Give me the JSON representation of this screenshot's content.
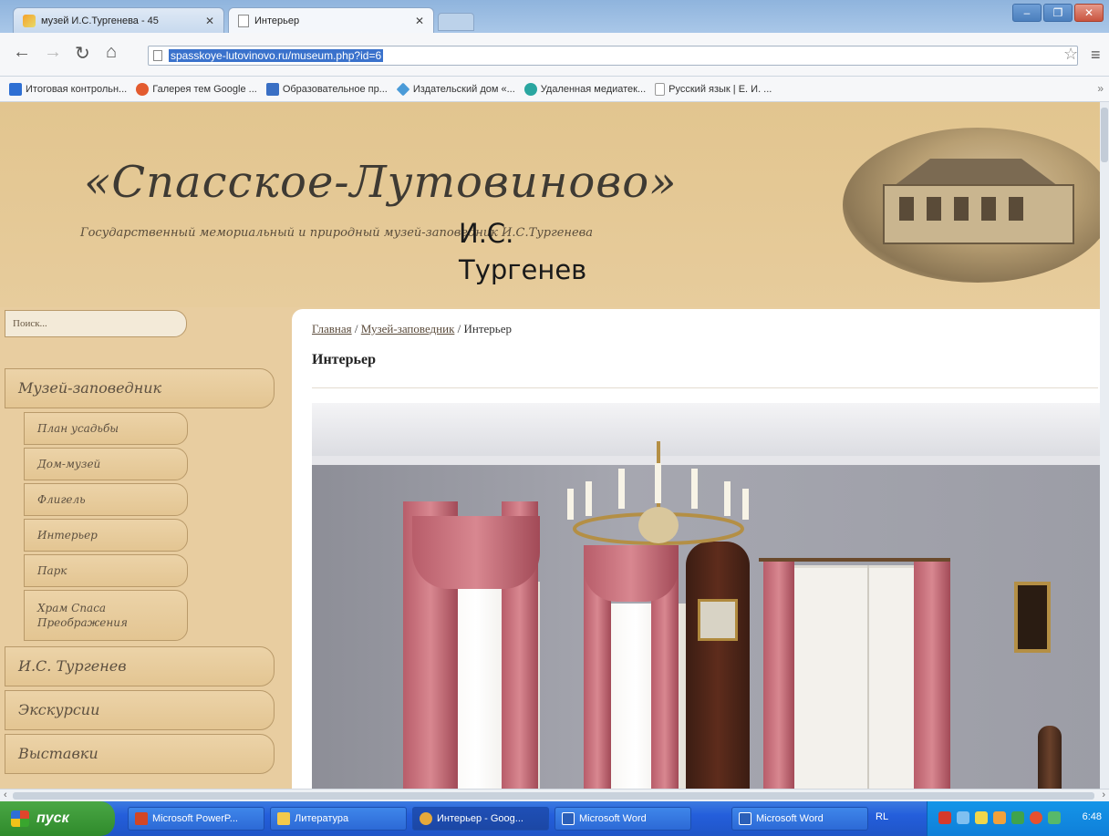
{
  "browser": {
    "tabs": [
      {
        "title": "музей И.С.Тургенева - 45",
        "active": false
      },
      {
        "title": "Интерьер",
        "active": true
      }
    ],
    "address": "spasskoye-lutovinovo.ru/museum.php?id=6",
    "bookmarks": [
      {
        "label": "Итоговая контрольн...",
        "icon": "app-icon",
        "color": "#2e6fd3"
      },
      {
        "label": "Галерея тем Google ...",
        "icon": "chrome-store-icon",
        "color": "#e35b2f"
      },
      {
        "label": "Образовательное пр...",
        "icon": "people-icon",
        "color": "#3a6fc4"
      },
      {
        "label": "Издательский дом «...",
        "icon": "diamond-icon",
        "color": "#4a9bd8"
      },
      {
        "label": "Удаленная медиатек...",
        "icon": "cloud-icon",
        "color": "#2aa6a0"
      },
      {
        "label": "Русский язык | Е. И. ...",
        "icon": "page-icon",
        "color": "#ffffff"
      }
    ]
  },
  "site": {
    "title": "«Спасское-Лутовиново»",
    "subtitle": "Государственный мемориальный и природный музей-заповедник И.С.Тургенева",
    "overlay_lines": [
      "И.С.",
      "Тургенев"
    ]
  },
  "sidebar": {
    "search_placeholder": "Поиск...",
    "sections": [
      {
        "label": "Музей-заповедник"
      },
      {
        "label": "И.С. Тургенев"
      },
      {
        "label": "Экскурсии"
      },
      {
        "label": "Выставки"
      }
    ],
    "subitems": [
      {
        "label": "План усадьбы"
      },
      {
        "label": "Дом-музей"
      },
      {
        "label": "Флигель"
      },
      {
        "label": "Интерьер"
      },
      {
        "label": "Парк"
      },
      {
        "label": "Храм Спаса Преображения"
      }
    ]
  },
  "content": {
    "breadcrumb": {
      "home": "Главная",
      "sep": " / ",
      "section": "Музей-заповедник",
      "current": "Интерьер"
    },
    "title": "Интерьер"
  },
  "taskbar": {
    "start": "пуск",
    "tasks": [
      {
        "label": "Microsoft PowerP...",
        "color": "#d24625",
        "active": false
      },
      {
        "label": "Литература",
        "color": "#f2c94c",
        "active": false
      },
      {
        "label": "Интерьер - Goog...",
        "color": "#e6a93a",
        "active": true
      },
      {
        "label": "Microsoft Word",
        "color": "#2b5fb8",
        "active": false
      },
      {
        "label": "Microsoft Word",
        "color": "#2b5fb8",
        "active": false
      }
    ],
    "lang": "RL",
    "time": "6:48"
  }
}
